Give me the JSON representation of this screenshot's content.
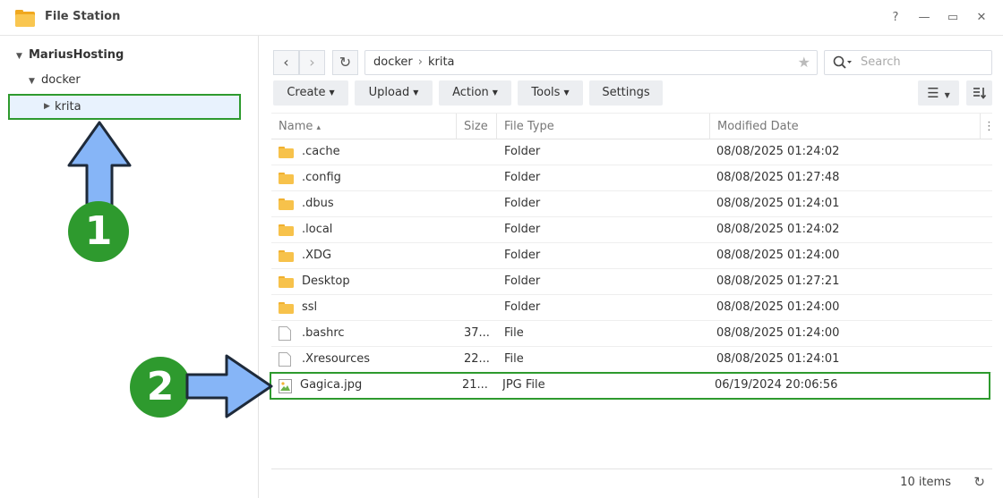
{
  "window": {
    "title": "File Station",
    "help": "?",
    "minimize": "—",
    "maximize": "▭",
    "close": "✕"
  },
  "sidebar": {
    "root": "MariusHosting",
    "folder": "docker",
    "selected": "krita"
  },
  "nav": {
    "back": "‹",
    "forward": "›",
    "refresh": "↻",
    "path": [
      "docker",
      "krita"
    ],
    "path_sep": "›",
    "star": "★",
    "search_placeholder": "Search"
  },
  "toolbar": {
    "create": "Create",
    "upload": "Upload",
    "action": "Action",
    "tools": "Tools",
    "settings": "Settings"
  },
  "columns": {
    "name": "Name",
    "sort_indicator": "▴",
    "size": "Size",
    "type": "File Type",
    "modified": "Modified Date",
    "more": "⋮"
  },
  "rows": [
    {
      "name": ".cache",
      "size": "",
      "type": "Folder",
      "modified": "08/08/2025 01:24:02",
      "icon": "folder-icon"
    },
    {
      "name": ".config",
      "size": "",
      "type": "Folder",
      "modified": "08/08/2025 01:27:48",
      "icon": "folder-icon"
    },
    {
      "name": ".dbus",
      "size": "",
      "type": "Folder",
      "modified": "08/08/2025 01:24:01",
      "icon": "folder-icon"
    },
    {
      "name": ".local",
      "size": "",
      "type": "Folder",
      "modified": "08/08/2025 01:24:02",
      "icon": "folder-icon"
    },
    {
      "name": ".XDG",
      "size": "",
      "type": "Folder",
      "modified": "08/08/2025 01:24:00",
      "icon": "folder-icon"
    },
    {
      "name": "Desktop",
      "size": "",
      "type": "Folder",
      "modified": "08/08/2025 01:27:21",
      "icon": "folder-icon"
    },
    {
      "name": "ssl",
      "size": "",
      "type": "Folder",
      "modified": "08/08/2025 01:24:00",
      "icon": "folder-icon"
    },
    {
      "name": ".bashrc",
      "size": "37...",
      "type": "File",
      "modified": "08/08/2025 01:24:00",
      "icon": "file-icon"
    },
    {
      "name": ".Xresources",
      "size": "22...",
      "type": "File",
      "modified": "08/08/2025 01:24:01",
      "icon": "file-icon"
    },
    {
      "name": "Gagica.jpg",
      "size": "21...",
      "type": "JPG File",
      "modified": "06/19/2024 20:06:56",
      "icon": "image-icon"
    }
  ],
  "footer": {
    "count": "10 items"
  },
  "annotations": {
    "step1": "1",
    "step2": "2"
  },
  "colors": {
    "highlight_border": "#2e9a2e",
    "badge": "#2e9a2e",
    "arrow_fill": "#86b5f7",
    "folder": "#f7c24b"
  }
}
